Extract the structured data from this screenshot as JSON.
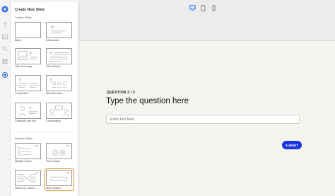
{
  "panel": {
    "title": "Create New Slide",
    "content_section": "Content Slides",
    "question_section": "Question Slides",
    "content_layouts": [
      {
        "label": "Blank",
        "icon": "blank-layout-icon"
      },
      {
        "label": "Introduction",
        "icon": "introduction-layout-icon"
      },
      {
        "label": "Title and image",
        "icon": "title-image-layout-icon"
      },
      {
        "label": "Title and text",
        "icon": "title-text-layout-icon"
      },
      {
        "label": "Comparison",
        "icon": "comparison-layout-icon"
      },
      {
        "label": "Meet the team",
        "icon": "meet-team-layout-icon"
      },
      {
        "label": "Character and text",
        "icon": "character-text-layout-icon"
      },
      {
        "label": "Conversation",
        "icon": "conversation-layout-icon"
      }
    ],
    "question_layouts": [
      {
        "label": "Multiple choice",
        "icon": "multiple-choice-layout-icon"
      },
      {
        "label": "True or false",
        "icon": "true-false-layout-icon"
      },
      {
        "label": "Match the column",
        "icon": "match-column-layout-icon"
      },
      {
        "label": "Short answer",
        "icon": "short-answer-layout-icon",
        "selected": true
      }
    ]
  },
  "rail": {
    "icons": [
      "add-icon",
      "text-icon",
      "media-icon",
      "search-icon",
      "grid-icon",
      "record-icon"
    ],
    "accent": "#2d6ae3"
  },
  "devices": [
    "desktop-icon",
    "tablet-icon",
    "mobile-icon"
  ],
  "main": {
    "question_number": "QUESTION 2 / 2",
    "question_title": "Type the question here",
    "answer_placeholder": "Enter text here",
    "submit_label": "SUBMIT"
  },
  "colors": {
    "submit": "#1a35e0",
    "selected_outline": "#e8922e",
    "canvas": "#f6f4ee",
    "topband": "#ececec"
  }
}
